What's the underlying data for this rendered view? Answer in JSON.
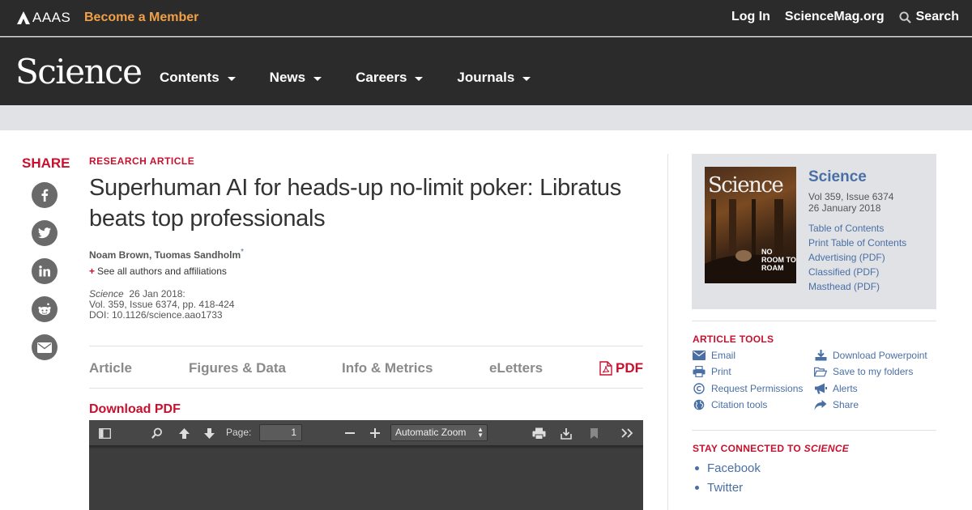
{
  "topbar": {
    "org": "AAAS",
    "become": "Become a Member",
    "login": "Log In",
    "site": "ScienceMag.org",
    "search": "Search"
  },
  "nav": {
    "logo": "Science",
    "items": [
      {
        "label": "Contents"
      },
      {
        "label": "News"
      },
      {
        "label": "Careers"
      },
      {
        "label": "Journals"
      }
    ]
  },
  "share": {
    "title": "SHARE",
    "icons": [
      "facebook-icon",
      "twitter-icon",
      "linkedin-icon",
      "reddit-icon",
      "email-icon"
    ]
  },
  "article": {
    "type": "RESEARCH ARTICLE",
    "title": "Superhuman AI for heads-up no-limit poker: Libratus beats top professionals",
    "authors": "Noam Brown, Tuomas Sandholm",
    "author_mark": "*",
    "affil_plus": "+",
    "affil": "See all authors and affiliations",
    "journal": "Science",
    "date": "26 Jan 2018:",
    "volume": "Vol. 359, Issue 6374, pp. 418-424",
    "doi": "DOI: 10.1126/science.aao1733"
  },
  "tabs": {
    "article": "Article",
    "figures": "Figures & Data",
    "info": "Info & Metrics",
    "eletters": "eLetters",
    "pdf": "PDF"
  },
  "download_pdf": "Download PDF",
  "viewer": {
    "page_label": "Page:",
    "page_value": "1",
    "zoom": "Automatic Zoom"
  },
  "issue": {
    "journal": "Science",
    "volume": "Vol 359, Issue 6374",
    "date": "26 January 2018",
    "cover_title": "Science",
    "cover_tag": "NO ROOM TO ROAM",
    "links": [
      "Table of Contents",
      "Print Table of Contents",
      "Advertising (PDF)",
      "Classified (PDF)",
      "Masthead (PDF)"
    ]
  },
  "tools": {
    "title": "ARTICLE TOOLS",
    "email": "Email",
    "print": "Print",
    "permissions": "Request Permissions",
    "citation": "Citation tools",
    "powerpoint": "Download Powerpoint",
    "folders": "Save to my folders",
    "alerts": "Alerts",
    "share": "Share"
  },
  "stay": {
    "title_prefix": "STAY CONNECTED TO",
    "title_journal": "SCIENCE",
    "links": [
      "Facebook",
      "Twitter"
    ]
  },
  "colors": {
    "accent_red": "#c8102e",
    "link_blue": "#4a6fa5",
    "member_orange": "#f0a046",
    "header_dark": "#2b2b2b"
  }
}
